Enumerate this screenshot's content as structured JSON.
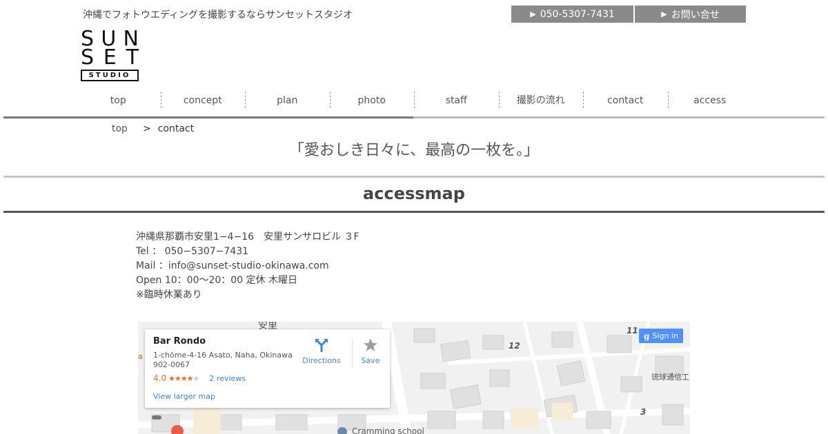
{
  "header": {
    "tagline": "沖縄でフォトウエディングを撮影するならサンセットスタジオ",
    "phone_button": "050-5307-7431",
    "contact_button": "お問い合せ",
    "logo": {
      "line1": [
        "S",
        "U",
        "N"
      ],
      "line2": [
        "S",
        "E",
        "T"
      ],
      "line3": "STUDIO"
    }
  },
  "nav": {
    "items": [
      "top",
      "concept",
      "plan",
      "photo",
      "staff",
      "撮影の流れ",
      "contact",
      "access"
    ]
  },
  "breadcrumb": {
    "home": "top",
    "separator": ">",
    "current": "contact"
  },
  "catchcopy": "「愛おしき日々に、最高の一枚を。」",
  "section": {
    "title": "accessmap"
  },
  "info": {
    "address": "沖縄県那覇市安里1−4−16　安里サンサロビル ３F",
    "tel": "Tel ： 050−5307−7431",
    "mail": "Mail ：info@sunset-studio-okinawa.com",
    "open": "Open 10：00〜20：00 定休 木曜日",
    "note": "※臨時休業あり"
  },
  "map": {
    "place_name": "Bar Rondo",
    "address": "1-chōme-4-16 Asato, Naha, Okinawa 902-0067",
    "rating": "4.0",
    "stars_filled": 4,
    "reviews": "2 reviews",
    "larger_map": "View larger map",
    "directions": "Directions",
    "save": "Save",
    "sign_in": "Sign in",
    "sign_in_logo": "g",
    "labels": {
      "block12": "12",
      "block11": "11",
      "block3": "3",
      "ryukyu": "琉球通信工",
      "asato": "安里",
      "school": "Cramming school",
      "a_left": "a"
    }
  },
  "colors": {
    "button_gray": "#8a8a8a",
    "map_link": "#3a84df",
    "rating_orange": "#e7711b",
    "signin_blue": "#4d90fe"
  }
}
